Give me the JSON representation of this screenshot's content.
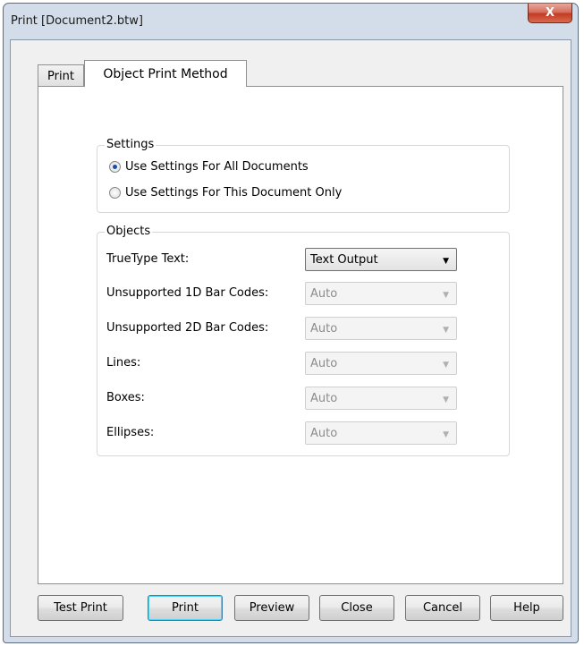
{
  "window": {
    "title": "Print [Document2.btw]",
    "close_label": "X"
  },
  "tabs": [
    {
      "label": "Print"
    },
    {
      "label": "Object Print Method"
    }
  ],
  "settings": {
    "group_label": "Settings",
    "options": [
      {
        "label": "Use Settings For All Documents",
        "selected": true
      },
      {
        "label": "Use Settings For This Document Only",
        "selected": false
      }
    ]
  },
  "objects": {
    "group_label": "Objects",
    "rows": [
      {
        "label": "TrueType Text:",
        "value": "Text Output",
        "enabled": true
      },
      {
        "label": "Unsupported 1D Bar Codes:",
        "value": "Auto",
        "enabled": false
      },
      {
        "label": "Unsupported 2D Bar Codes:",
        "value": "Auto",
        "enabled": false
      },
      {
        "label": "Lines:",
        "value": "Auto",
        "enabled": false
      },
      {
        "label": "Boxes:",
        "value": "Auto",
        "enabled": false
      },
      {
        "label": "Ellipses:",
        "value": "Auto",
        "enabled": false
      }
    ]
  },
  "buttons": {
    "test_print": "Test Print",
    "print": "Print",
    "preview": "Preview",
    "close": "Close",
    "cancel": "Cancel",
    "help": "Help"
  }
}
